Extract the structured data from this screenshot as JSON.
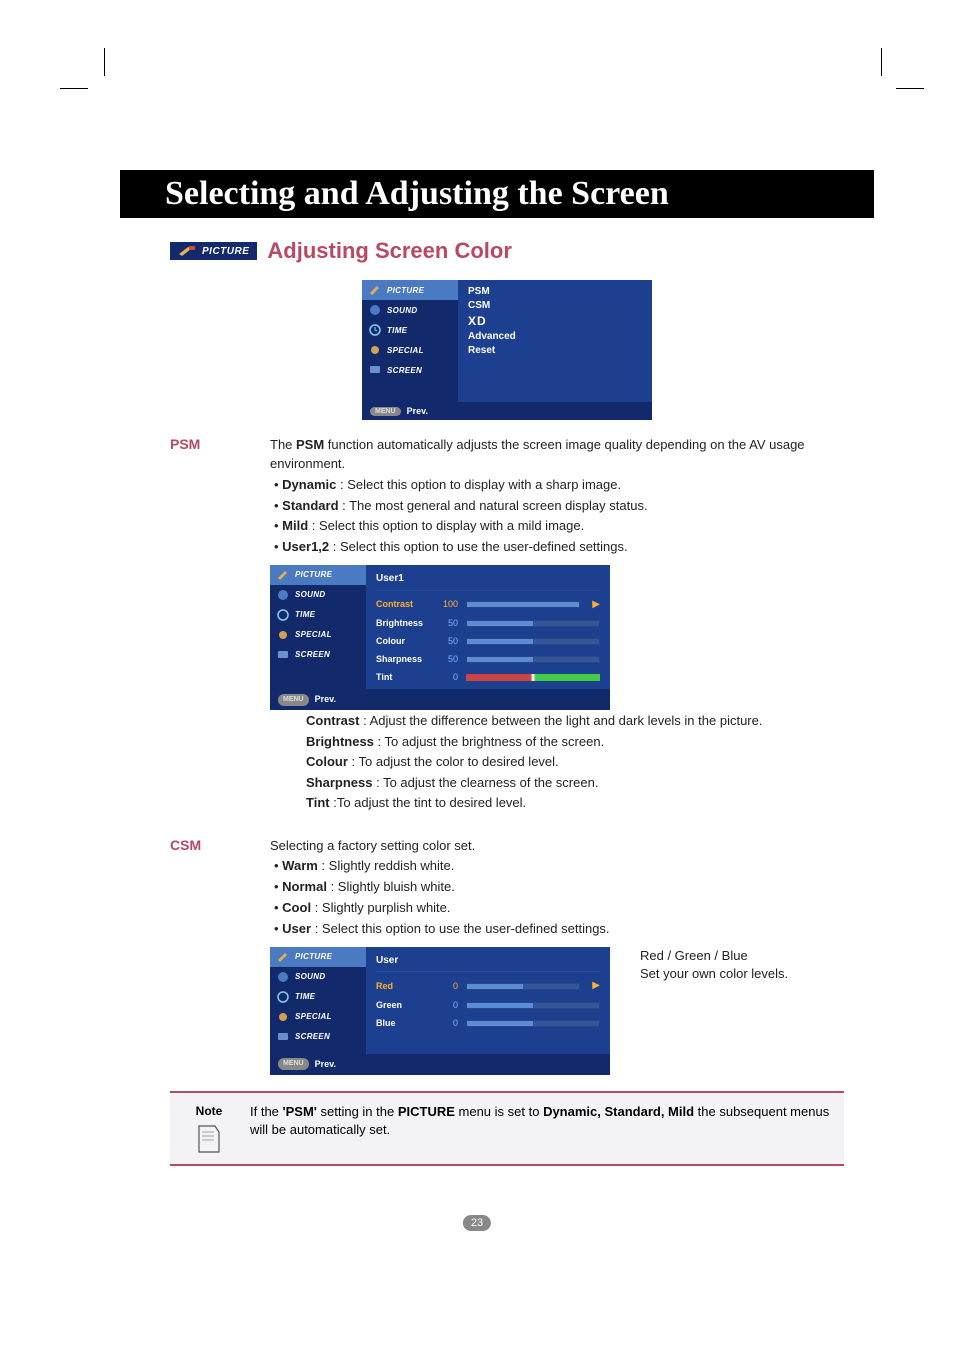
{
  "page": {
    "title": "Selecting and Adjusting the Screen",
    "picture_tag": "PICTURE",
    "section_title": "Adjusting Screen Color",
    "page_number": "23"
  },
  "osd_main": {
    "tabs": [
      "PICTURE",
      "SOUND",
      "TIME",
      "SPECIAL",
      "SCREEN"
    ],
    "items": [
      "PSM",
      "CSM",
      "XD",
      "Advanced",
      "Reset"
    ],
    "footer_button": "MENU",
    "footer_text": "Prev."
  },
  "psm": {
    "label": "PSM",
    "intro_a": "The ",
    "intro_b": "PSM",
    "intro_c": " function automatically adjusts the screen image quality depending on the AV usage environment.",
    "bullets": [
      {
        "name": "Dynamic",
        "desc": " : Select this option to display with a sharp image."
      },
      {
        "name": "Standard",
        "desc": " : The most general and natural screen display status."
      },
      {
        "name": "Mild",
        "desc": " : Select this option to display with a mild image."
      },
      {
        "name": "User1,2",
        "desc": " : Select this option to use the user-defined settings."
      }
    ]
  },
  "osd_user1": {
    "heading": "User1",
    "rows": [
      {
        "label": "Contrast",
        "value": "100",
        "fill": 100,
        "selected": true
      },
      {
        "label": "Brightness",
        "value": "50",
        "fill": 50,
        "selected": false
      },
      {
        "label": "Colour",
        "value": "50",
        "fill": 50,
        "selected": false
      },
      {
        "label": "Sharpness",
        "value": "50",
        "fill": 50,
        "selected": false
      },
      {
        "label": "Tint",
        "value": "0",
        "fill": 0,
        "selected": false,
        "tint": true
      }
    ]
  },
  "desc": {
    "contrast_l": "Contrast",
    "contrast_t": " : Adjust the difference between the light and dark levels in the picture.",
    "brightness_l": "Brightness",
    "brightness_t": " : To adjust the brightness of the screen.",
    "colour_l": "Colour",
    "colour_t": " : To adjust the color to desired level.",
    "sharpness_l": "Sharpness",
    "sharpness_t": " : To adjust the clearness of the screen.",
    "tint_l": "Tint",
    "tint_t": " :To adjust the tint to desired level."
  },
  "csm": {
    "label": "CSM",
    "intro": "Selecting a factory setting color set.",
    "bullets": [
      {
        "name": "Warm",
        "desc": " : Slightly reddish white."
      },
      {
        "name": "Normal",
        "desc": " : Slightly bluish white."
      },
      {
        "name": "Cool",
        "desc": " : Slightly purplish white."
      },
      {
        "name": "User",
        "desc": " : Select this option to use the user-defined settings."
      }
    ]
  },
  "osd_user": {
    "heading": "User",
    "rows": [
      {
        "label": "Red",
        "value": "0",
        "fill": 50,
        "selected": true
      },
      {
        "label": "Green",
        "value": "0",
        "fill": 50,
        "selected": false
      },
      {
        "label": "Blue",
        "value": "0",
        "fill": 50,
        "selected": false
      }
    ]
  },
  "rgb": {
    "title": "Red / Green / Blue",
    "text": "Set your own color levels."
  },
  "note": {
    "label": "Note",
    "text_a": "If the ",
    "text_b": "'PSM'",
    "text_c": " setting in the ",
    "text_d": "PICTURE",
    "text_e": " menu is set to ",
    "text_f": "Dynamic, Standard, Mild",
    "text_g": " the subsequent menus will be automatically set."
  },
  "chart_data": [
    {
      "type": "bar",
      "title": "User1",
      "categories": [
        "Contrast",
        "Brightness",
        "Colour",
        "Sharpness",
        "Tint"
      ],
      "values": [
        100,
        50,
        50,
        50,
        0
      ],
      "xlabel": "",
      "ylabel": "",
      "ylim": [
        0,
        100
      ]
    },
    {
      "type": "bar",
      "title": "User",
      "categories": [
        "Red",
        "Green",
        "Blue"
      ],
      "values": [
        0,
        0,
        0
      ],
      "xlabel": "",
      "ylabel": "",
      "ylim": [
        -50,
        50
      ]
    }
  ]
}
